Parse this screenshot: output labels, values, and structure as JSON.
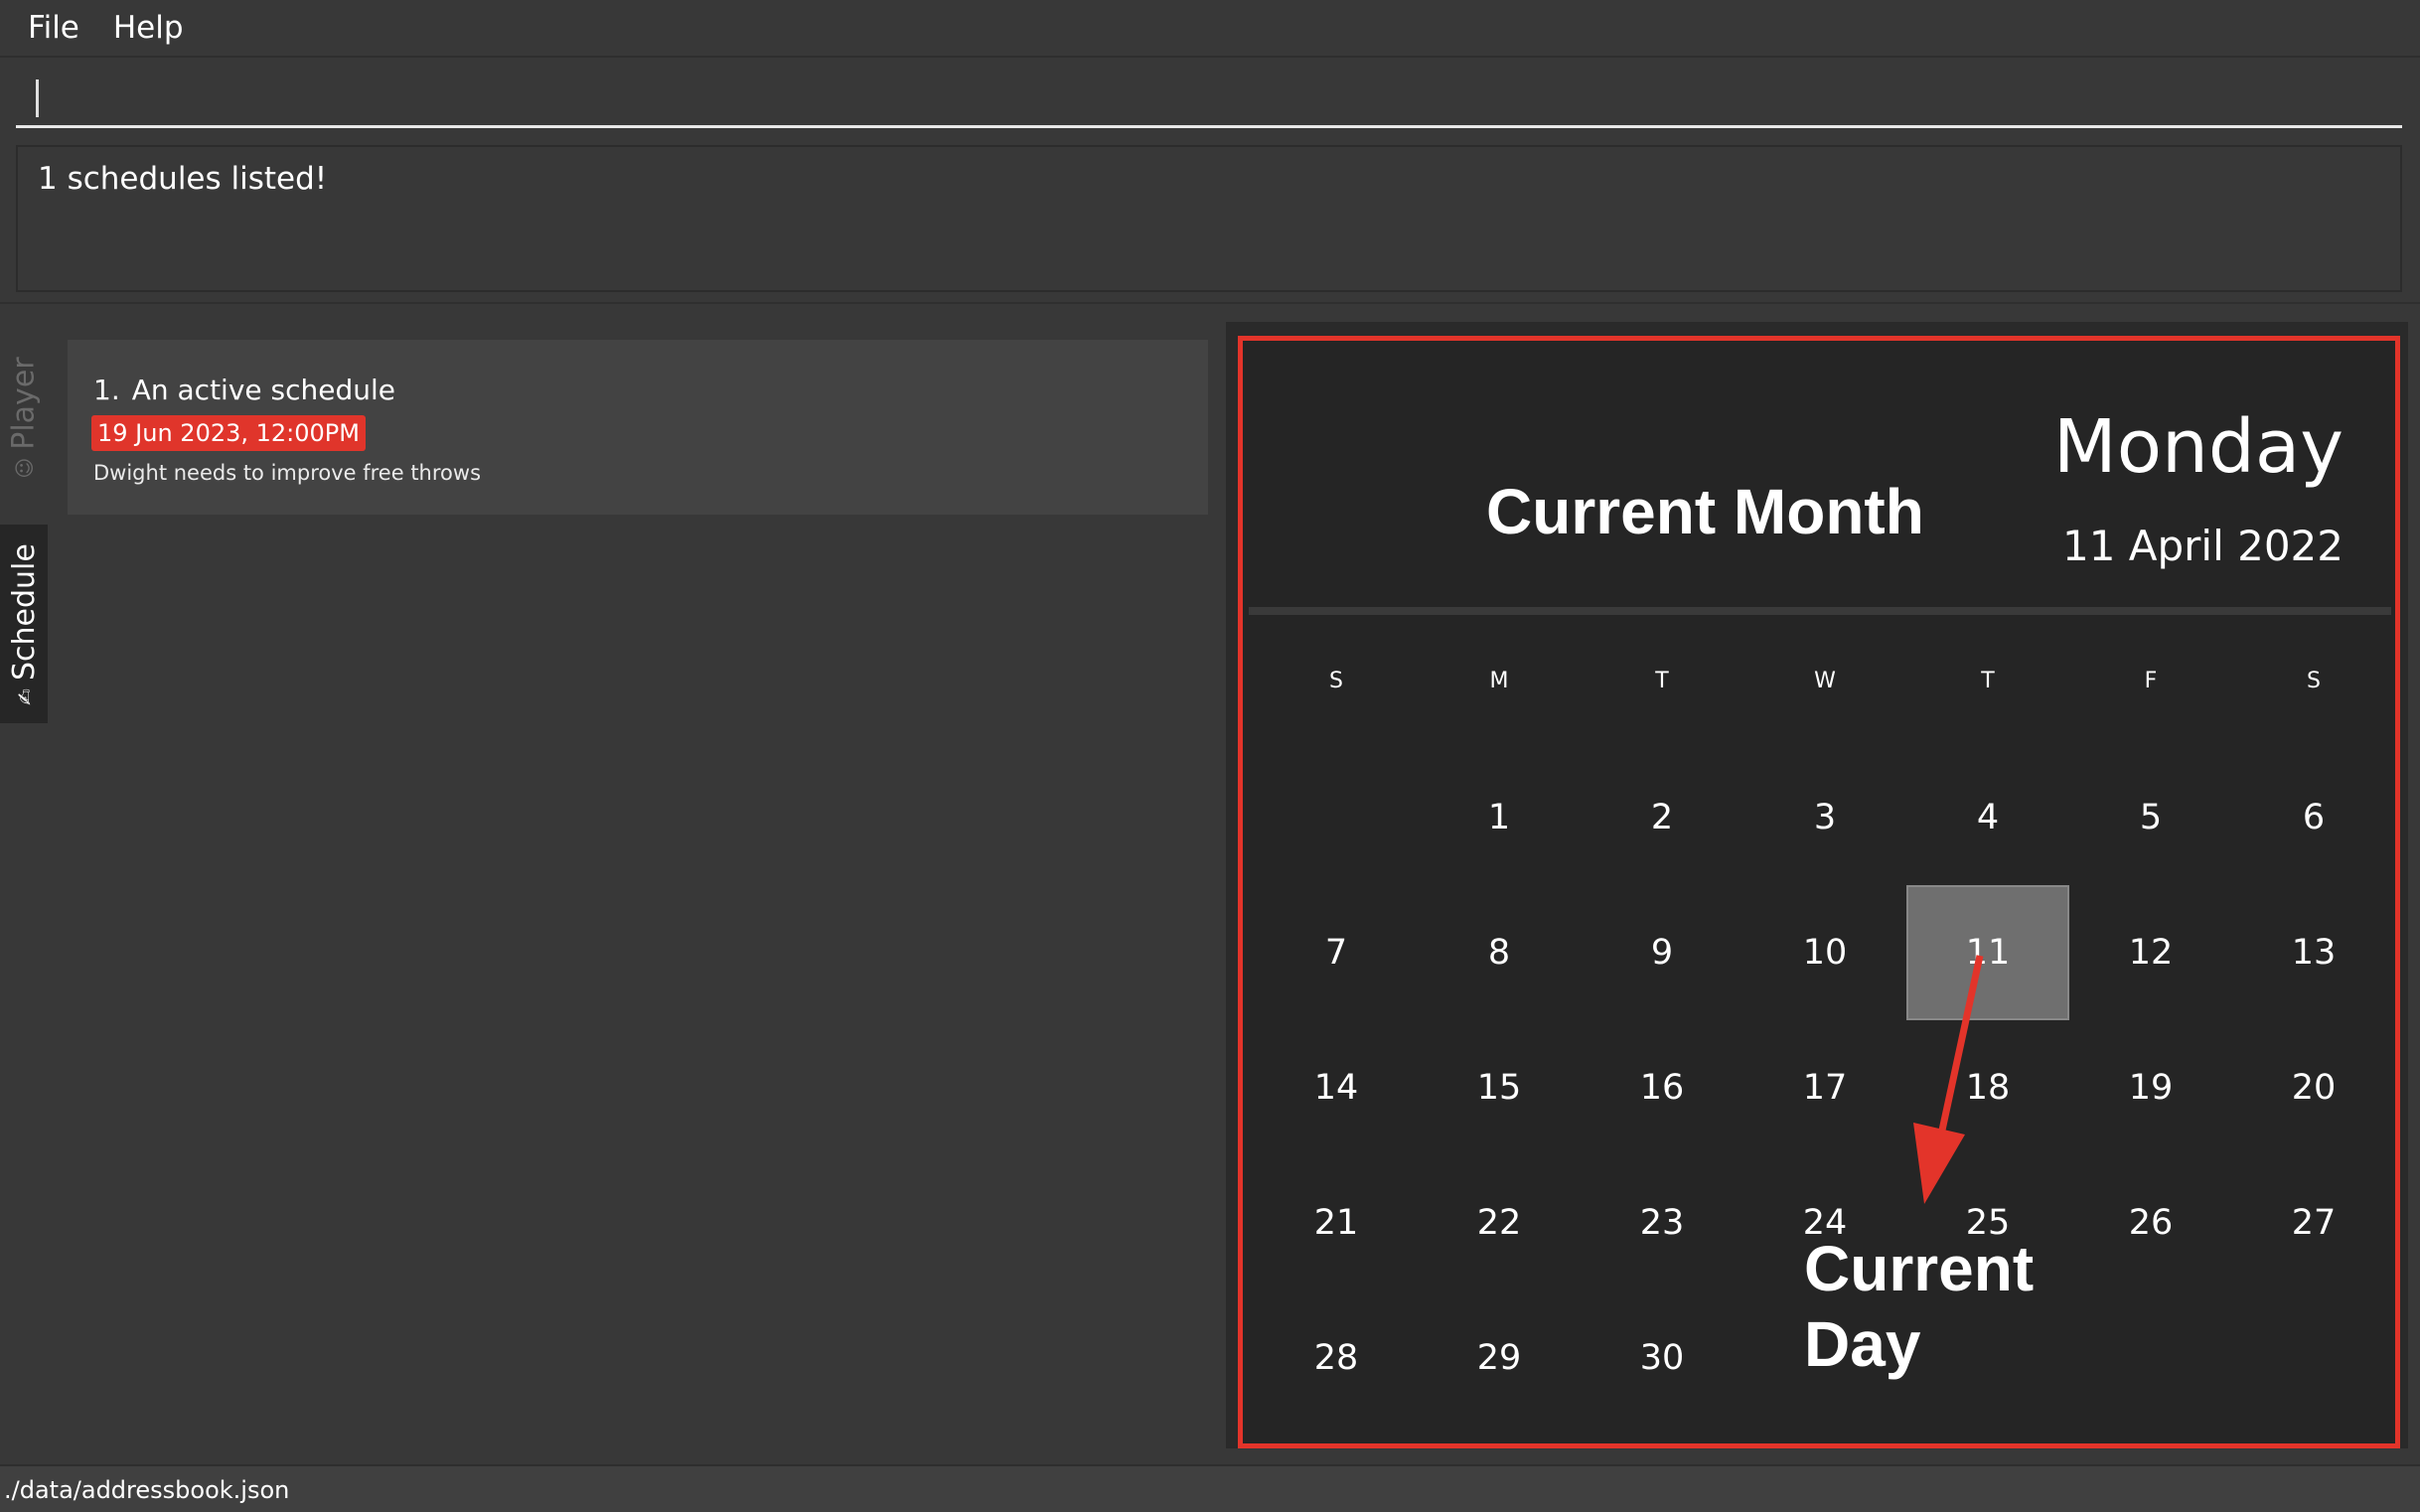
{
  "menu": {
    "file": "File",
    "help": "Help"
  },
  "command_box": {
    "value": ""
  },
  "result_display": {
    "text": "1 schedules listed!"
  },
  "tabs": [
    {
      "label": "Player",
      "icon": "player-icon",
      "active": false
    },
    {
      "label": "Schedule",
      "icon": "schedule-icon",
      "active": true
    }
  ],
  "schedules": [
    {
      "index": "1.",
      "title": "An active schedule",
      "datetime": "19 Jun 2023, 12:00PM",
      "description": "Dwight needs to improve free throws",
      "badge_color": "#e0352b"
    }
  ],
  "calendar": {
    "day_name": "Monday",
    "full_date": "11 April 2022",
    "weekdays": [
      "S",
      "M",
      "T",
      "W",
      "T",
      "F",
      "S"
    ],
    "first_weekday_index": 1,
    "days_in_month": 30,
    "today": 11
  },
  "annotations": {
    "current_month": "Current Month",
    "current_day": "Current\nDay",
    "frame_color": "#e3342a"
  },
  "status_bar": {
    "path": "./data/addressbook.json"
  }
}
